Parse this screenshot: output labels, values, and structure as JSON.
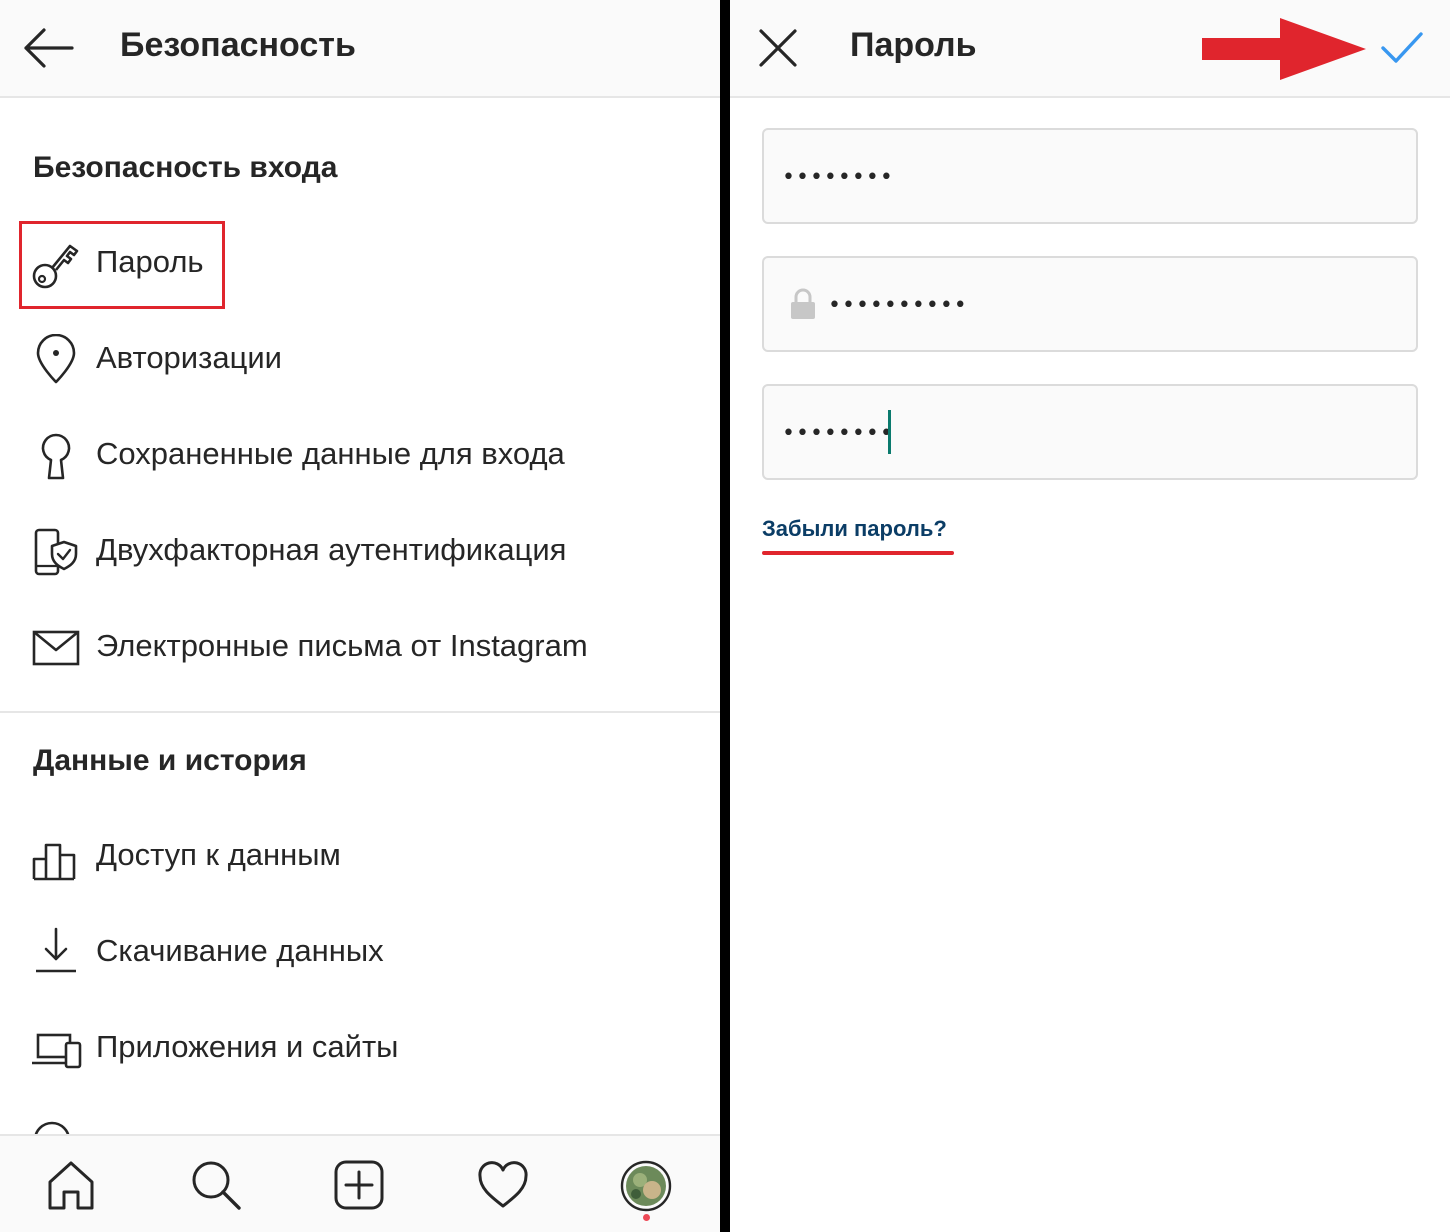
{
  "left_screen": {
    "header": {
      "title": "Безопасность",
      "back_icon": "arrow-left-icon"
    },
    "login_security": {
      "title": "Безопасность входа",
      "items": [
        {
          "label": "Пароль",
          "icon": "key-icon",
          "highlighted": true
        },
        {
          "label": "Авторизации",
          "icon": "location-pin-icon"
        },
        {
          "label": "Сохраненные данные для входа",
          "icon": "keyhole-icon"
        },
        {
          "label": "Двухфакторная аутентификация",
          "icon": "phone-shield-icon"
        },
        {
          "label": "Электронные письма от Instagram",
          "icon": "mail-icon"
        }
      ]
    },
    "data_history": {
      "title": "Данные и история",
      "items": [
        {
          "label": "Доступ к данным",
          "icon": "bar-chart-icon"
        },
        {
          "label": "Скачивание данных",
          "icon": "download-icon"
        },
        {
          "label": "Приложения и сайты",
          "icon": "devices-icon"
        }
      ]
    },
    "bottom_nav": [
      "home-icon",
      "search-icon",
      "new-post-icon",
      "heart-icon",
      "profile-avatar"
    ],
    "highlight_color": "#e0252d"
  },
  "right_screen": {
    "header": {
      "title": "Пароль",
      "close_icon": "close-icon",
      "confirm_icon": "checkmark-icon",
      "confirm_color": "#3897f0"
    },
    "fields": [
      {
        "name": "current-password",
        "value": "••••••••"
      },
      {
        "name": "new-password",
        "value": "••••••••••",
        "lock_icon": "lock-icon"
      },
      {
        "name": "confirm-password",
        "value": "••••••••••"
      }
    ],
    "forgot_link": "Забыли пароль?",
    "annotation_arrow_color": "#e0252d"
  }
}
